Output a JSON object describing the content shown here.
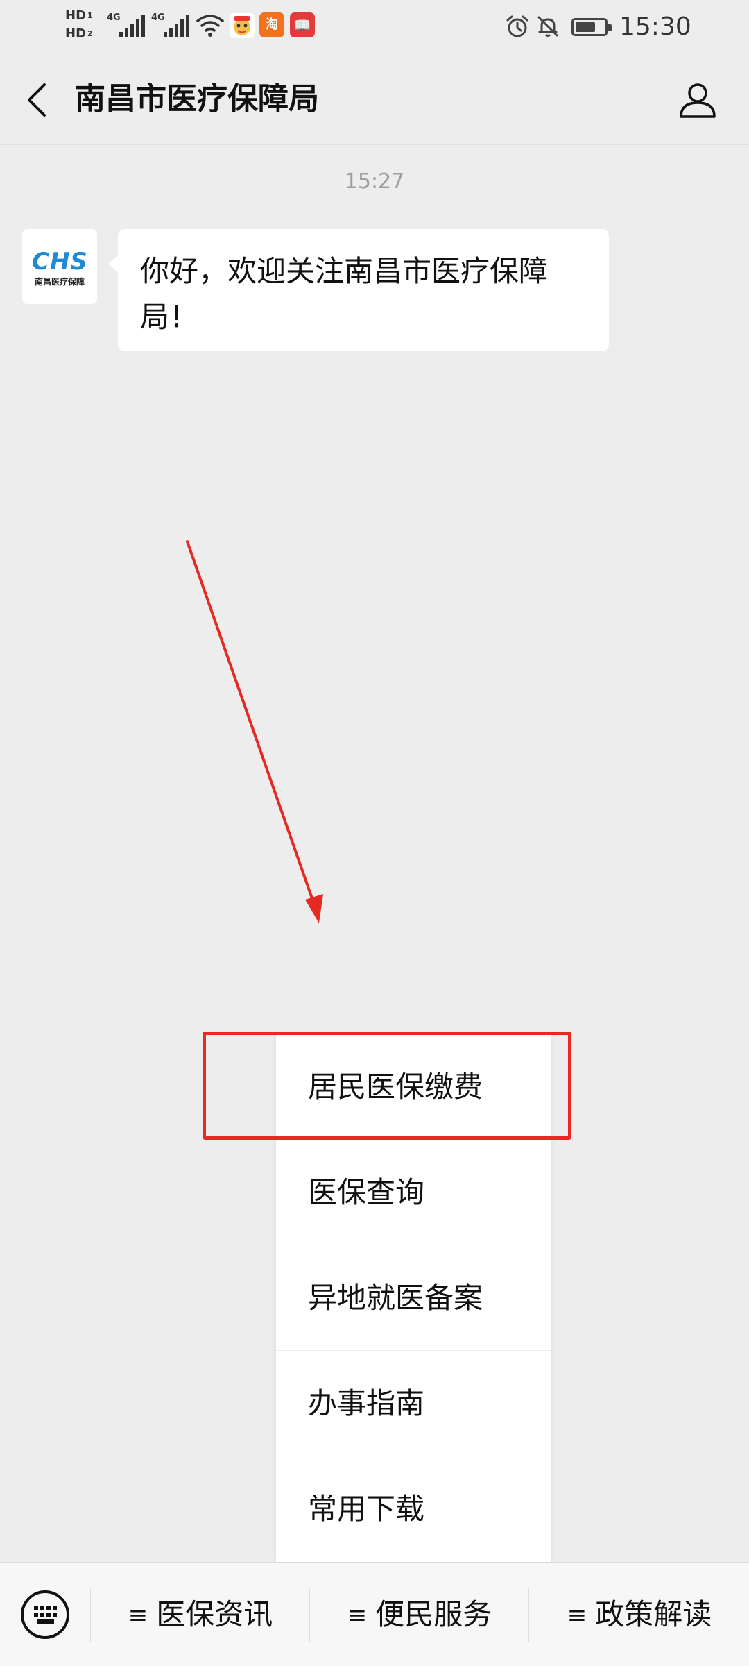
{
  "status_bar": {
    "hd_labels": [
      "HD",
      "HD"
    ],
    "hd_subs": [
      "1",
      "2"
    ],
    "network_labels": [
      "4G",
      "4G"
    ],
    "time": "15:30",
    "app_icons": [
      {
        "name": "taobao-app-icon",
        "glyph": "淘",
        "color": "#f2711c"
      },
      {
        "name": "reader-app-icon",
        "glyph": "📖",
        "color": "#e33b3b"
      }
    ],
    "battery_level": 0.7
  },
  "nav": {
    "title": "南昌市医疗保障局"
  },
  "chat": {
    "timestamp": "15:27",
    "avatar": {
      "logo_text": "CHS",
      "org_text": "南昌医疗保障"
    },
    "message": "你好，欢迎关注南昌市医疗保障局！"
  },
  "menu": {
    "items": [
      "居民医保缴费",
      "医保查询",
      "异地就医备案",
      "办事指南",
      "常用下载"
    ]
  },
  "bottom_bar": {
    "tabs": [
      "医保资讯",
      "便民服务",
      "政策解读"
    ],
    "hamburger_glyph": "≡"
  },
  "colors": {
    "annotation_red": "#e62a22",
    "logo_blue": "#1e8ad6"
  }
}
